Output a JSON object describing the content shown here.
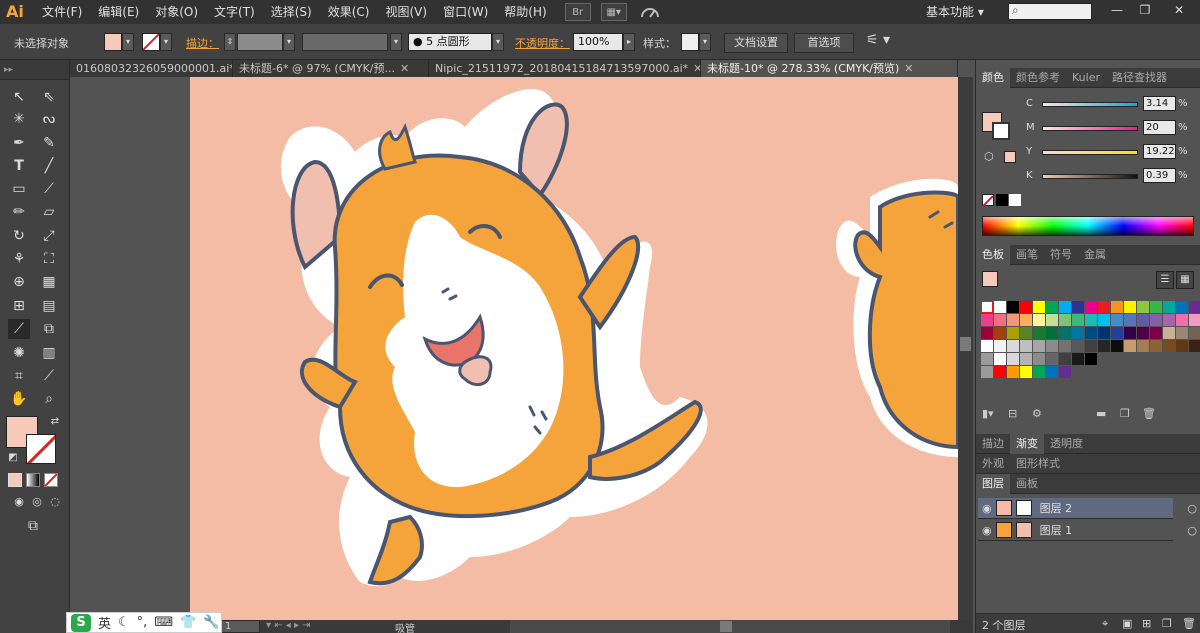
{
  "app": {
    "logo": "Ai"
  },
  "menu": [
    "文件(F)",
    "编辑(E)",
    "对象(O)",
    "文字(T)",
    "选择(S)",
    "效果(C)",
    "视图(V)",
    "窗口(W)",
    "帮助(H)"
  ],
  "menu_icons": {
    "bridge": "Br",
    "arrange": "▦▾"
  },
  "workspace": "基本功能",
  "window_buttons": {
    "minimize": "—",
    "restore": "❐",
    "close": "✕"
  },
  "control": {
    "selection": "未选择对象",
    "stroke_label": "描边：",
    "brush_value": "5 点圆形",
    "opacity_label": "不透明度：",
    "opacity_value": "100%",
    "style_label": "样式：",
    "doc_setup": "文档设置",
    "prefs": "首选项"
  },
  "tabs": [
    {
      "label": "01608032326059000001.ai*",
      "active": false
    },
    {
      "label": "未标题-6* @ 97% (CMYK/预...",
      "active": false
    },
    {
      "label": "Nipic_21511972_20180415184713597000.ai*",
      "active": false
    },
    {
      "label": "未标题-10* @ 278.33% (CMYK/预览)",
      "active": true
    }
  ],
  "color_panel": {
    "tabs": [
      "颜色",
      "颜色参考",
      "Kuler",
      "路径查找器"
    ],
    "channels": [
      {
        "label": "C",
        "value": "3.14",
        "pct": "%",
        "level": 0.03
      },
      {
        "label": "M",
        "value": "20",
        "pct": "%",
        "level": 0.2
      },
      {
        "label": "Y",
        "value": "19.22",
        "pct": "%",
        "level": 0.19
      },
      {
        "label": "K",
        "value": "0.39",
        "pct": "%",
        "level": 0.0
      }
    ]
  },
  "swatch_panel": {
    "tabs": [
      "色板",
      "画笔",
      "符号",
      "金属"
    ]
  },
  "stroke_panel": {
    "tabs": [
      "描边",
      "渐变",
      "透明度"
    ]
  },
  "appearance_panel": {
    "tabs": [
      "外观",
      "图形样式"
    ]
  },
  "layers_panel": {
    "tabs": [
      "图层",
      "画板"
    ],
    "layers": [
      {
        "name": "图层 2",
        "selected": true
      },
      {
        "name": "图层 1",
        "selected": false
      }
    ],
    "count": "2 个图层"
  },
  "status": {
    "zoom": "1",
    "tool": "吸管"
  },
  "ime": {
    "lang": "英"
  },
  "colors": {
    "artboard": "#f4bca4",
    "fill": "#f7c9b8",
    "hamster_orange": "#f4a43a",
    "outline": "#4a5570"
  }
}
